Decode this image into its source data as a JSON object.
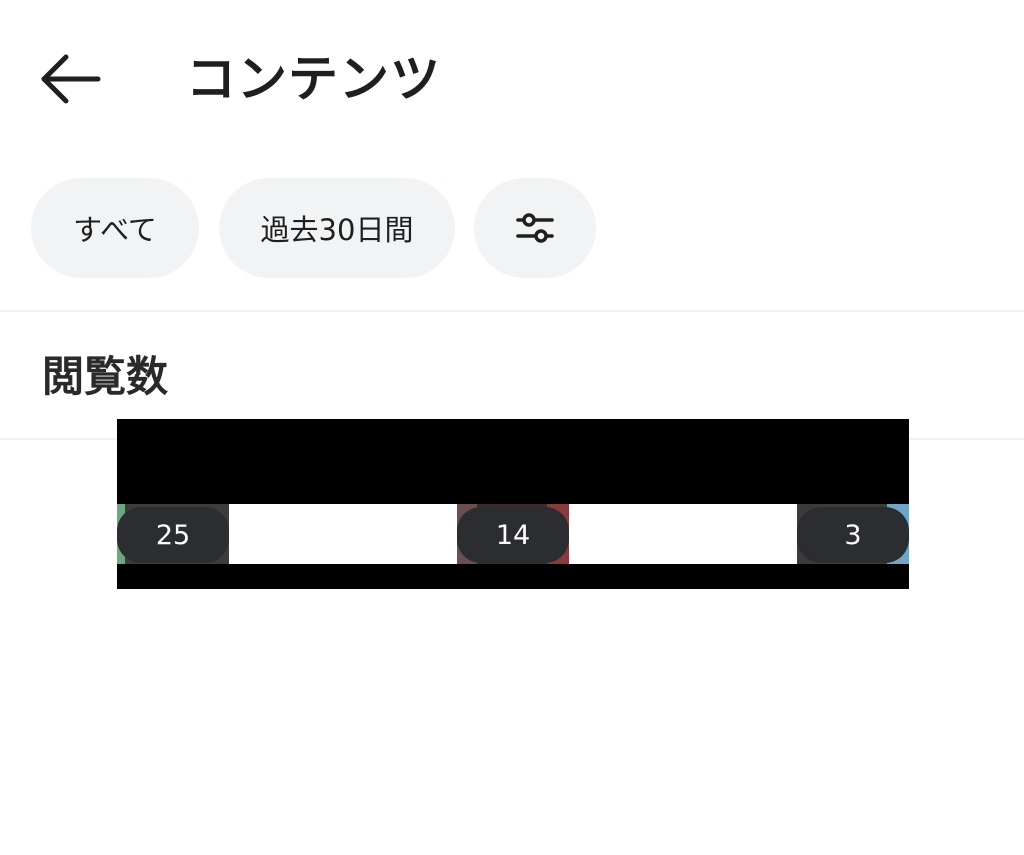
{
  "header": {
    "back_icon": "arrow-left-icon",
    "title": "コンテンツ"
  },
  "filters": {
    "all_label": "すべて",
    "period_label": "過去30日間",
    "settings_icon": "sliders-icon"
  },
  "section": {
    "title": "閲覧数"
  },
  "items": [
    {
      "views": "25"
    },
    {
      "views": "14"
    },
    {
      "views": "3"
    }
  ],
  "colors": {
    "chip_bg": "#f1f3f5",
    "badge_bg": "#2b2d31",
    "text": "#1f1f1f",
    "redaction": "#000000"
  }
}
